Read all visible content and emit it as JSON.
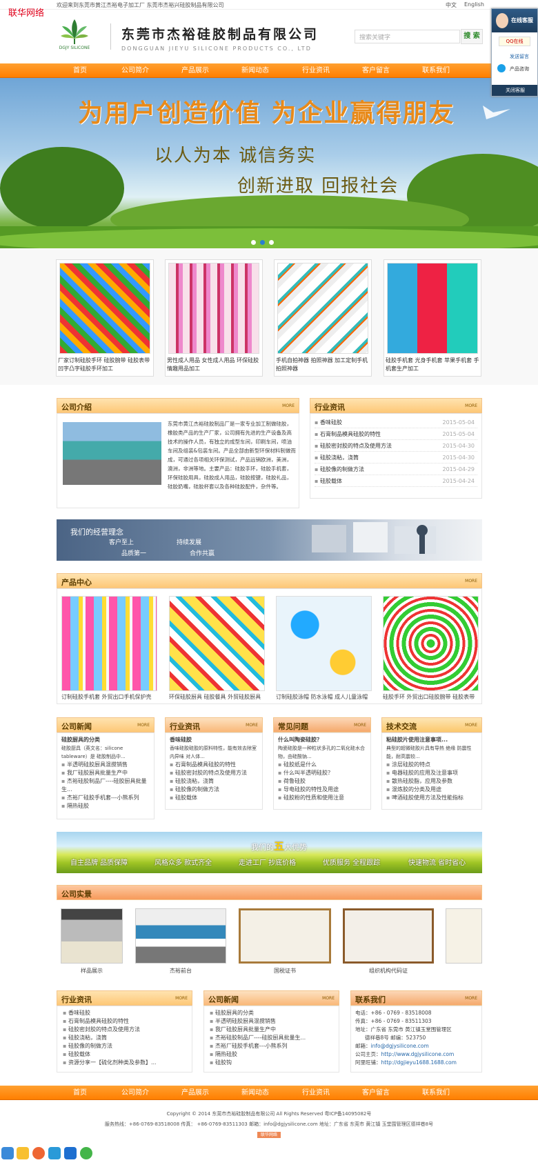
{
  "watermark": "联华网络",
  "topbar": {
    "welcome": "欢迎来到东莞市黄江杰裕电子加工厂  东莞市杰裕兴硅胶制品有限公司",
    "lang_cn": "中文",
    "lang_en": "English"
  },
  "header": {
    "logo_brand": "DGJY SILICONE",
    "company_cn": "东莞市杰裕硅胶制品有限公司",
    "company_en": "DONGGUAN JIEYU SILICONE PRODUCTS CO., LTD",
    "search_placeholder": "搜索关键字",
    "search_button": "搜 索"
  },
  "nav": [
    "首页",
    "公司简介",
    "产品展示",
    "新闻动态",
    "行业资讯",
    "客户留言",
    "联系我们"
  ],
  "banner": {
    "line1": "为用户创造价值   为企业赢得朋友",
    "line2": "以人为本   诚信务实",
    "line3": "创新进取   回报社会",
    "slide_count": 3,
    "active_slide": 2
  },
  "featured_products": [
    {
      "caption": "厂家订制硅胶手环 硅胶腕带 硅胶表带 凹字凸字硅胶手环加工"
    },
    {
      "caption": "男性成人用品 女性成人用品 环保硅胶情趣用品加工"
    },
    {
      "caption": "手机自拍神器 拍照神器 加工定制手机拍照神器"
    },
    {
      "caption": "硅胶手机套 光身手机套 苹果手机套 手机套生产加工"
    }
  ],
  "about": {
    "title": "公司介绍",
    "more": "MORE",
    "text": "东莞市黄江杰裕硅胶制品厂是一家专业加工制做硅胶，橡胶类产品的生产厂家，公司拥有先进的生产设备及高技术的操作人员，有独立的成型车间，印刷车间，喷油车间及组装&包装车间。产品全部由新型环保材料制做而成，可通过各项相关环保测试，产品远销欧洲，美洲，澳洲，非洲等地。主要产品：硅胶手环，硅胶手机套，环保硅胶用具，硅胶成人用品，硅胶按键，硅胶礼品，硅胶奶嘴，硅胶杯套以及各种硅胶配件，杂件等。"
  },
  "industry_news": {
    "title": "行业资讯",
    "more": "MORE",
    "items": [
      {
        "title": "香味硅胶",
        "date": "2015-05-04"
      },
      {
        "title": "石膏制品模具硅胶的特性",
        "date": "2015-05-04"
      },
      {
        "title": "硅胶密封胶的特点及使用方法",
        "date": "2015-04-30"
      },
      {
        "title": "硅胶浇粘，浇筒",
        "date": "2015-04-30"
      },
      {
        "title": "硅胶像的制做方法",
        "date": "2015-04-29"
      },
      {
        "title": "硅胶载体",
        "date": "2015-04-24"
      }
    ]
  },
  "idea": {
    "title": "我们的经营理念",
    "words": [
      "客户至上",
      "持续发展",
      "品质第一",
      "合作共赢"
    ]
  },
  "product_center": {
    "title": "产品中心",
    "more": "MORE",
    "items": [
      {
        "caption": "订制硅胶手机套 外贸出口手机保护壳"
      },
      {
        "caption": "环保硅胶厨具 硅胶餐具 外贸硅胶厨具"
      },
      {
        "caption": "订制硅胶泳帽 防水泳帽 成人儿童泳帽"
      },
      {
        "caption": "硅胶手环 外贸出口硅胶腕带 硅胶表带"
      }
    ]
  },
  "four_cols": [
    {
      "title": "公司新闻",
      "more": "MORE",
      "lead_title": "硅胶厨具的分类",
      "lead_text": "硅胶厨具（英文名：silicone tableware）是 硅胶制品中...",
      "items": [
        "半透明硅胶厨具混搅销售",
        "我厂硅胶厨具批量生产中",
        "杰裕硅胶制品厂----硅胶厨具批量生...",
        "杰裕厂硅胶手机套---小熊系列",
        "隔热硅胶"
      ]
    },
    {
      "title": "行业资讯",
      "more": "MORE",
      "lead_title": "香味硅胶",
      "lead_text": "香味硅胶硅胶的原料特性，能有效去除室内异味 对人体...",
      "items": [
        "石膏制品模具硅胶的特性",
        "硅胶密封胶的特点及使用方法",
        "硅胶浇粘，浇筒",
        "硅胶像的制做方法",
        "硅胶载体"
      ]
    },
    {
      "title": "常见问题",
      "more": "MORE",
      "lead_title": "什么叫陶瓷硅胶？",
      "lead_text": "陶瓷硅胶是一种粒状多孔的二氧化硅水合物，由硅酸钠...",
      "items": [
        "硅胶纸是什么",
        "什么叫半透明硅胶？",
        "荷鲁硅胶",
        "导电硅胶的特性及用途",
        "硅胶粉的性质和使用注意"
      ]
    },
    {
      "title": "技术交流",
      "more": "MORE",
      "lead_title": "粘硅胶片使用注意事项...",
      "lead_text": "典型的超微硅胶片具有导热 绝缘 防震性能，耐高震较...",
      "items": [
        "涂层硅胶的特点",
        "电器硅胶的应用及注意事项",
        "散热硅胶脂，应用及参数",
        "混炼胶的分类及用途",
        "啤酒硅胶使用方法及性能指标"
      ]
    }
  ],
  "advantage": {
    "title_pre": "我们的",
    "title_num": "五",
    "title_post": "大优势",
    "items": [
      "自主品牌 品质保障",
      "风格众多 款式齐全",
      "走进工厂 抄底价格",
      "优质服务 全程跟踪",
      "快速物流 省时省心"
    ]
  },
  "company_photos": {
    "title": "公司实景",
    "items": [
      "样品展示",
      "杰裕前台",
      "国税证书",
      "组织机构代码证",
      ""
    ]
  },
  "bottom_cols": {
    "industry": {
      "title": "行业资讯",
      "more": "MORE",
      "items": [
        "香味硅胶",
        "石膏制品模具硅胶的特性",
        "硅胶密封胶的特点及使用方法",
        "硅胶浇粘，浇筒",
        "硅胶像的制做方法",
        "硅胶载体",
        "资源分享一【硫化剂种类及参数】..."
      ]
    },
    "news": {
      "title": "公司新闻",
      "more": "MORE",
      "items": [
        "硅胶厨具的分类",
        "半透明硅胶厨具混搅销售",
        "我厂硅胶厨具批量生产中",
        "杰裕硅胶制品厂----硅胶厨具批量生...",
        "杰裕厂硅胶手机套---小熊系列",
        "隔热硅胶",
        "硅胶钩"
      ]
    },
    "contact": {
      "title": "联系我们",
      "more": "MORE",
      "lines": [
        "电话：+86 - 0769 - 83518008",
        "传真：+86 - 0769 - 83511303",
        "地址：广东省 东莞市 黄江镇玉堂围管理区",
        "德祥巷8号    邮编：523750"
      ],
      "email_label": "邮箱：",
      "email": "info@dgjysilicone.com",
      "site_label": "公司主页：",
      "site": "http://www.dgjysilicone.com",
      "shop_label": "阿里旺铺：",
      "shop": "http://dgjieyu1688.1688.com"
    }
  },
  "footer": {
    "copyright": "Copyright © 2014 东莞市杰裕硅胶制品有限公司 All Rights Reserved 粤ICP备14095082号",
    "service": "服务热线：+86-0769-83518008 传真： +86-0769-83511303 邮箱：info@dgjysilicone.com 地址：广东省 东莞市 黄江镇 玉堂围管理区德祥巷8号",
    "badge": "联华网络"
  },
  "side_widget": {
    "title": "在线客服",
    "qq": "QQ在线",
    "send_msg": "发送留言",
    "consult": "产品咨询",
    "close": "关闭客服"
  },
  "colors": {
    "orange": "#ff8a00",
    "box_header": "#fdc877",
    "green": "#2d8a2a",
    "link_blue": "#2466a8"
  }
}
